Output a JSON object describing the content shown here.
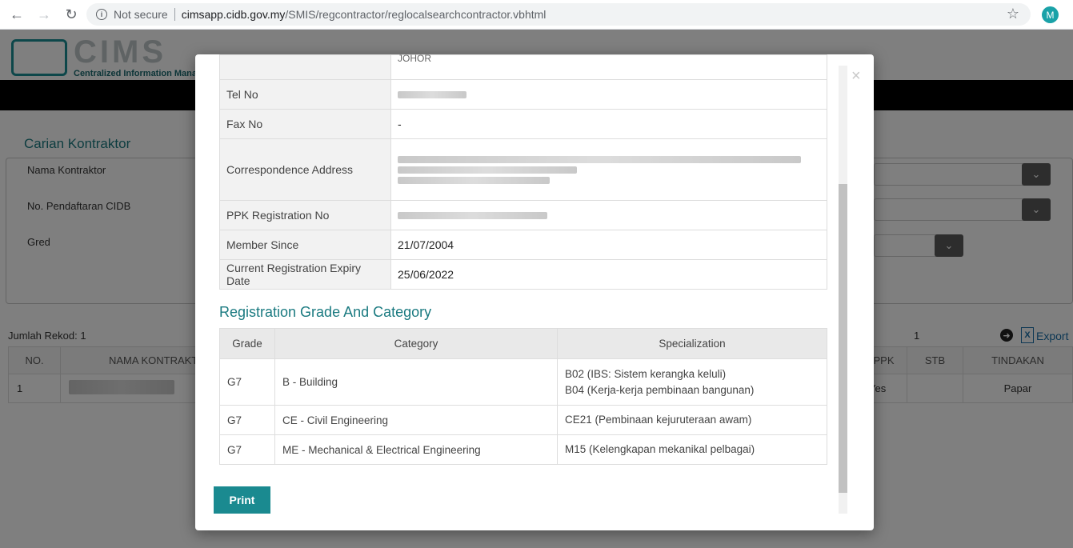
{
  "browser": {
    "security_label": "Not secure",
    "url_host": "cimsapp.cidb.gov.my",
    "url_path": "/SMIS/regcontractor/reglocalsearchcontractor.vbhtml",
    "profile_initial": "M"
  },
  "page": {
    "logo_text": "CIMS",
    "logo_subtitle": "Centralized Information Manag",
    "section_title": "Carian Kontraktor",
    "fields": {
      "nama_kontraktor": "Nama Kontraktor",
      "no_pendaftaran": "No. Pendaftaran CIDB",
      "gred": "Gred"
    },
    "record_count": "Jumlah Rekod: 1",
    "page_number": "1",
    "export_label": "Export",
    "table_headers": {
      "no": "NO.",
      "nama": "NAMA KONTRAKT",
      "ppk": "PPK",
      "stb": "STB",
      "tindakan": "TINDAKAN"
    },
    "row": {
      "no": "1",
      "ppk": "Yes",
      "tindakan": "Papar"
    }
  },
  "modal": {
    "info_rows": {
      "cut_value": "JOHOR",
      "tel_label": "Tel No",
      "fax_label": "Fax No",
      "fax_value": "-",
      "address_label": "Correspondence Address",
      "ppk_label": "PPK Registration No",
      "member_since_label": "Member Since",
      "member_since_value": "21/07/2004",
      "expiry_label": "Current Registration Expiry Date",
      "expiry_value": "25/06/2022"
    },
    "grade_section_title": "Registration Grade And Category",
    "grade_headers": {
      "grade": "Grade",
      "category": "Category",
      "specialization": "Specialization"
    },
    "grades": [
      {
        "grade": "G7",
        "category": "B - Building",
        "spec1": "B02 (IBS: Sistem kerangka keluli)",
        "spec2": "B04 (Kerja-kerja pembinaan bangunan)"
      },
      {
        "grade": "G7",
        "category": "CE - Civil Engineering",
        "spec1": "CE21 (Pembinaan kejuruteraan awam)"
      },
      {
        "grade": "G7",
        "category": "ME - Mechanical & Electrical Engineering",
        "spec1": "M15 (Kelengkapan mekanikal pelbagai)"
      }
    ],
    "print_label": "Print"
  }
}
